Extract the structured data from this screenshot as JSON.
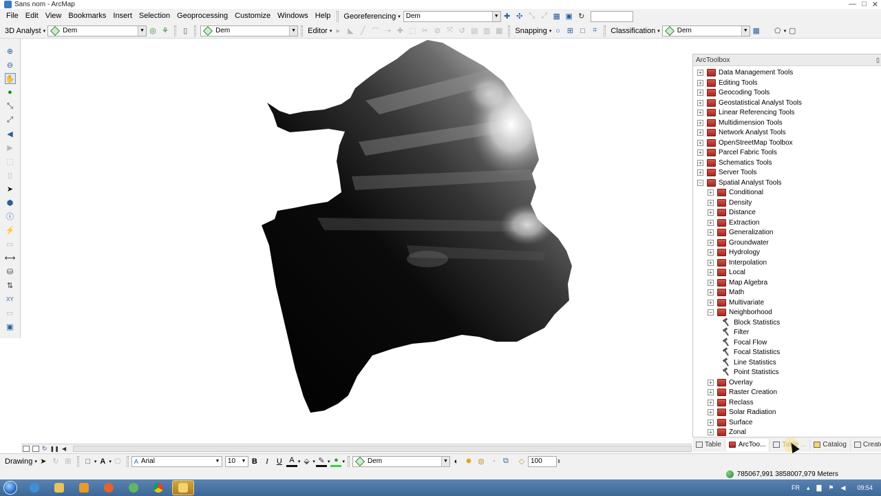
{
  "window": {
    "title": "Sans nom - ArcMap",
    "controls": [
      "—",
      "□",
      "✕"
    ]
  },
  "menubar": {
    "items": [
      "File",
      "Edit",
      "View",
      "Bookmarks",
      "Insert",
      "Selection",
      "Geoprocessing",
      "Customize",
      "Windows",
      "Help"
    ],
    "georeferencing": {
      "label": "Georeferencing",
      "layer": "Dem"
    }
  },
  "toolbar": {
    "analyst3d_label": "3D Analyst",
    "analyst3d_layer": "Dem",
    "layer_combo_2": "Dem",
    "editor_label": "Editor",
    "snapping_label": "Snapping",
    "classification_label": "Classification",
    "classification_layer": "Dem"
  },
  "arctoolbox": {
    "title": "ArcToolbox",
    "toolboxes": [
      "Data Management Tools",
      "Editing Tools",
      "Geocoding Tools",
      "Geostatistical Analyst Tools",
      "Linear Referencing Tools",
      "Multidimension Tools",
      "Network Analyst Tools",
      "OpenStreetMap Toolbox",
      "Parcel Fabric Tools",
      "Schematics Tools",
      "Server Tools",
      "Spatial Analyst Tools"
    ],
    "spatial_analyst_toolsets": [
      "Conditional",
      "Density",
      "Distance",
      "Extraction",
      "Generalization",
      "Groundwater",
      "Hydrology",
      "Interpolation",
      "Local",
      "Map Algebra",
      "Math",
      "Multivariate",
      "Neighborhood"
    ],
    "neighborhood_tools": [
      "Block Statistics",
      "Filter",
      "Focal Flow",
      "Focal Statistics",
      "Line Statistics",
      "Point Statistics"
    ],
    "remaining_toolsets": [
      "Overlay",
      "Raster Creation",
      "Reclass",
      "Solar Radiation",
      "Surface",
      "Zonal"
    ]
  },
  "dock_tabs": [
    {
      "label": "Table",
      "state": "normal"
    },
    {
      "label": "ArcToo...",
      "state": "active"
    },
    {
      "label": "Table ...",
      "state": "dim"
    },
    {
      "label": "Catalog",
      "state": "normal"
    },
    {
      "label": "Create",
      "state": "normal"
    }
  ],
  "drawing": {
    "label": "Drawing",
    "font": "Arial",
    "font_size": "10",
    "layer": "Dem",
    "transparency": "100"
  },
  "status": {
    "coordinates": "785067,991  3858007,979 Meters"
  },
  "taskbar": {
    "lang": "FR",
    "time": "09:54"
  }
}
